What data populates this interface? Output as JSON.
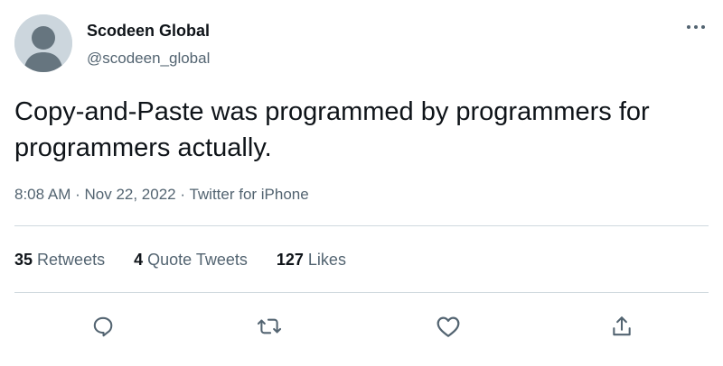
{
  "author": {
    "display_name": "Scodeen Global",
    "handle": "@scodeen_global"
  },
  "tweet": {
    "text": "Copy-and-Paste was programmed by programmers for programmers actually.",
    "time": "8:08 AM",
    "date": "Nov 22, 2022",
    "source": "Twitter for iPhone",
    "separator": " · "
  },
  "stats": {
    "retweets_count": "35",
    "retweets_label": "Retweets",
    "quote_count": "4",
    "quote_label": "Quote Tweets",
    "likes_count": "127",
    "likes_label": "Likes"
  },
  "icons": {
    "more": "more-horizontal-icon",
    "reply": "reply-icon",
    "retweet": "retweet-icon",
    "like": "heart-icon",
    "share": "share-icon"
  },
  "colors": {
    "text_primary": "#0f1419",
    "text_secondary": "#536471",
    "divider": "#cfd9de",
    "avatar_bg": "#ccd6dd"
  }
}
